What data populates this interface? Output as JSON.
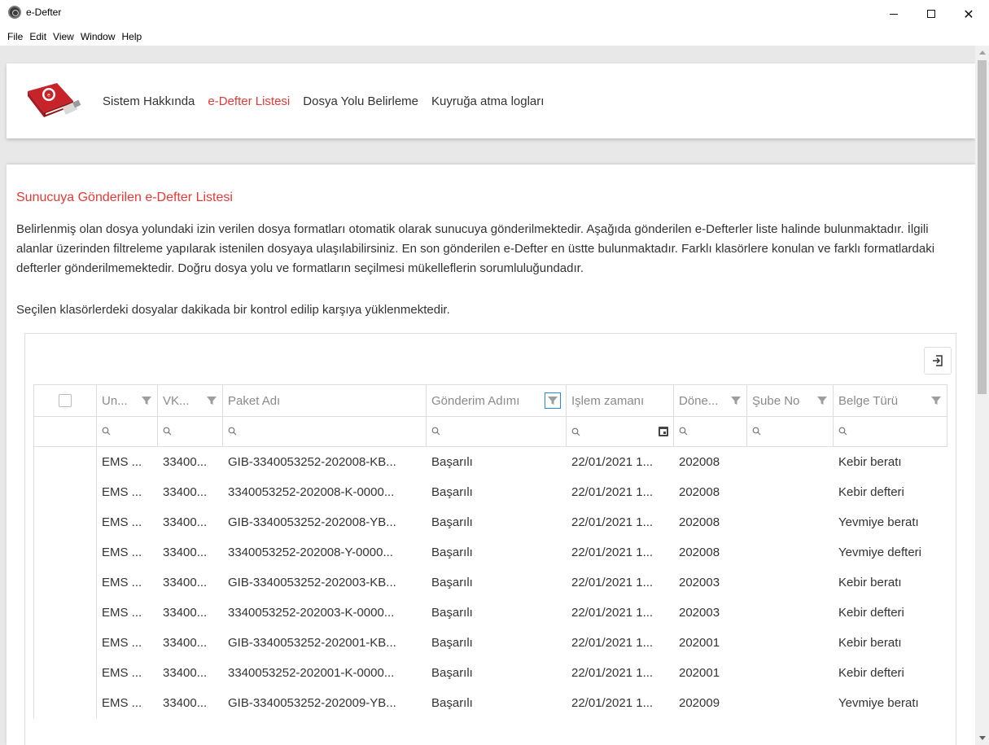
{
  "window": {
    "title": "e-Defter",
    "controls": {
      "minimize": "–",
      "maximize": "□",
      "close": "✕"
    }
  },
  "menu": [
    "File",
    "Edit",
    "View",
    "Window",
    "Help"
  ],
  "nav": {
    "items": [
      {
        "label": "Sistem Hakkında",
        "active": false
      },
      {
        "label": "e-Defter Listesi",
        "active": true
      },
      {
        "label": "Dosya Yolu Belirleme",
        "active": false
      },
      {
        "label": "Kuyruğa atma logları",
        "active": false
      }
    ]
  },
  "page": {
    "title": "Sunucuya Gönderilen e-Defter Listesi",
    "description": "Belirlenmiş olan dosya yolundaki izin verilen dosya formatları otomatik olarak sunucuya gönderilmektedir. Aşağıda gönderilen e-Defterler liste halinde bulunmaktadır. İlgili alanlar üzerinden filtreleme yapılarak istenilen dosyaya ulaşılabilirsiniz. En son gönderilen e-Defter en üstte bulunmaktadır. Farklı klasörlere konulan ve farklı formatlardaki defterler gönderilmemektedir. Doğru dosya yolu ve formatların seçilmesi mükelleflerin sorumluluğundadır.",
    "note": "Seçilen klasörlerdeki dosyalar dakikada bir kontrol edilip karşıya yüklenmektedir."
  },
  "grid": {
    "columns": [
      {
        "label": "Un...",
        "filter": true
      },
      {
        "label": "VK...",
        "filter": true
      },
      {
        "label": "Paket Adı",
        "filter": false
      },
      {
        "label": "Gönderim Adımı",
        "filter": true,
        "filter_active": true
      },
      {
        "label": "Işlem zamanı",
        "filter": false
      },
      {
        "label": "Döne...",
        "filter": true
      },
      {
        "label": "Şube No",
        "filter": true
      },
      {
        "label": "Belge Türü",
        "filter": true
      }
    ],
    "rows": [
      [
        "EMS ...",
        "33400...",
        "GIB-3340053252-202008-KB...",
        "Başarılı",
        "22/01/2021 1...",
        "202008",
        "",
        "Kebir beratı"
      ],
      [
        "EMS ...",
        "33400...",
        "3340053252-202008-K-0000...",
        "Başarılı",
        "22/01/2021 1...",
        "202008",
        "",
        "Kebir defteri"
      ],
      [
        "EMS ...",
        "33400...",
        "GIB-3340053252-202008-YB...",
        "Başarılı",
        "22/01/2021 1...",
        "202008",
        "",
        "Yevmiye beratı"
      ],
      [
        "EMS ...",
        "33400...",
        "3340053252-202008-Y-0000...",
        "Başarılı",
        "22/01/2021 1...",
        "202008",
        "",
        "Yevmiye defteri"
      ],
      [
        "EMS ...",
        "33400...",
        "GIB-3340053252-202003-KB...",
        "Başarılı",
        "22/01/2021 1...",
        "202003",
        "",
        "Kebir beratı"
      ],
      [
        "EMS ...",
        "33400...",
        "3340053252-202003-K-0000...",
        "Başarılı",
        "22/01/2021 1...",
        "202003",
        "",
        "Kebir defteri"
      ],
      [
        "EMS ...",
        "33400...",
        "GIB-3340053252-202001-KB...",
        "Başarılı",
        "22/01/2021 1...",
        "202001",
        "",
        "Kebir beratı"
      ],
      [
        "EMS ...",
        "33400...",
        "3340053252-202001-K-0000...",
        "Başarılı",
        "22/01/2021 1...",
        "202001",
        "",
        "Kebir defteri"
      ],
      [
        "EMS ...",
        "33400...",
        "GIB-3340053252-202009-YB...",
        "Başarılı",
        "22/01/2021 1...",
        "202009",
        "",
        "Yevmiye beratı"
      ]
    ]
  },
  "icons": {
    "app": "app-logo-icon",
    "export": "export-icon",
    "filter": "funnel-icon",
    "search": "search-icon",
    "calendar": "calendar-icon"
  },
  "colors": {
    "accent": "#e53935",
    "filter_active_border": "#2a8ad4",
    "muted_header": "#8a8a8a"
  }
}
